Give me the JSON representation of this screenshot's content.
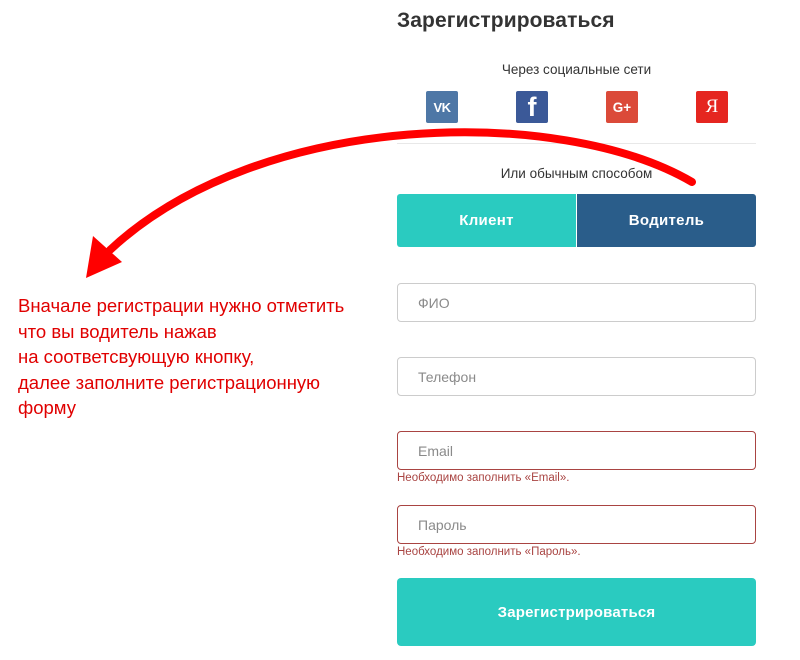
{
  "form": {
    "title": "Зарегистрироваться",
    "social_caption": "Через социальные сети",
    "social": [
      {
        "name": "vk",
        "glyph": "VK",
        "color": "#4e77a6"
      },
      {
        "name": "facebook",
        "glyph": "f",
        "color": "#3b5998"
      },
      {
        "name": "google-plus",
        "glyph": "G+",
        "color": "#db4a39"
      },
      {
        "name": "yandex",
        "glyph": "Я",
        "color": "#e52620"
      }
    ],
    "alt_caption": "Или обычным способом",
    "roles": {
      "client_label": "Клиент",
      "driver_label": "Водитель"
    },
    "fields": {
      "fio_placeholder": "ФИО",
      "phone_placeholder": "Телефон",
      "email_placeholder": "Email",
      "password_placeholder": "Пароль"
    },
    "errors": {
      "email": "Необходимо заполнить «Email».",
      "password": "Необходимо заполнить «Пароль»."
    },
    "submit_label": "Зарегистрироваться"
  },
  "annotation": {
    "lines": [
      "Вначале регистрации нужно отметить",
      "что вы водитель нажав",
      "на соответсвующую кнопку,",
      "далее заполните регистрационную",
      "форму"
    ],
    "color": "#e00000"
  },
  "colors": {
    "accent_teal": "#2acbc0",
    "driver_blue": "#2a5d8a",
    "error_red": "#a94442"
  }
}
